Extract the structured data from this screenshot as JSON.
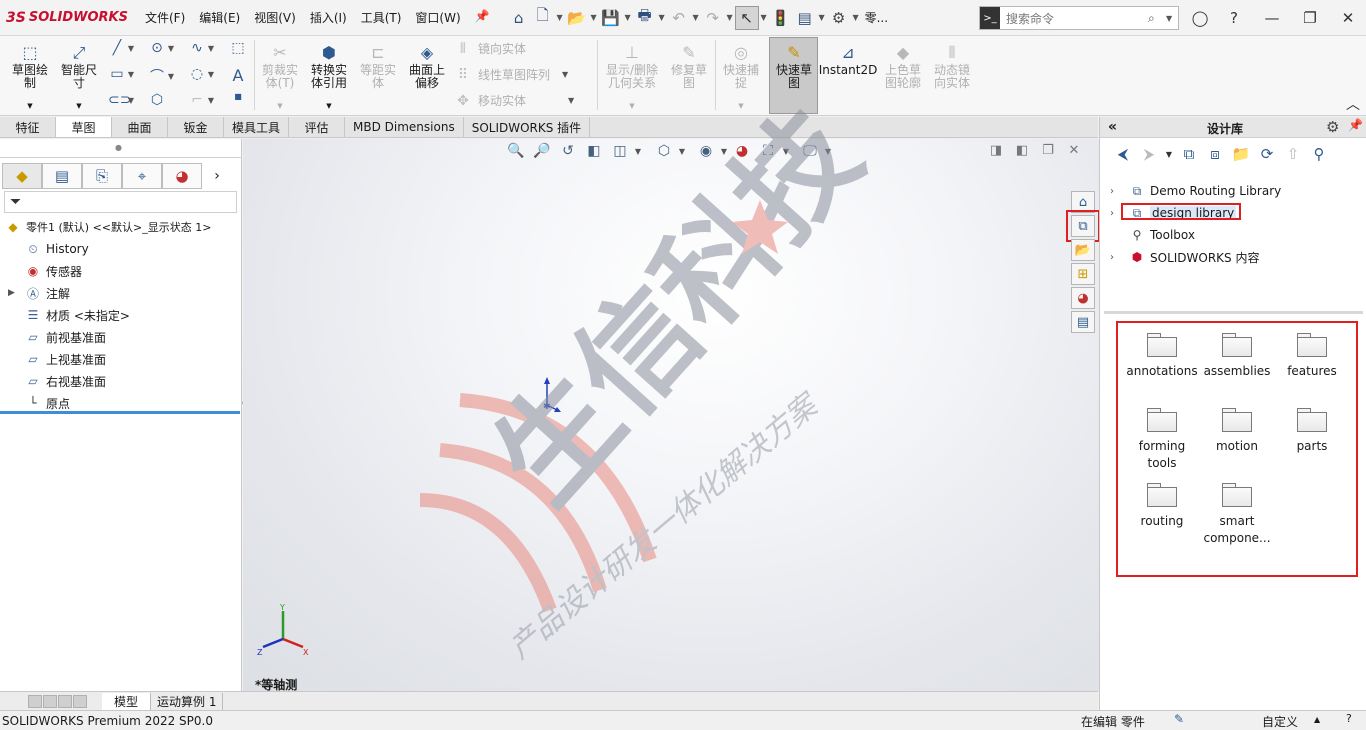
{
  "app": {
    "logo_prefix": "3S",
    "logo_text": "SOLIDWORKS"
  },
  "menu": [
    "文件(F)",
    "编辑(E)",
    "视图(V)",
    "插入(I)",
    "工具(T)",
    "窗口(W)"
  ],
  "quick_access": {
    "doc_short": "零..."
  },
  "search": {
    "placeholder": "搜索命令"
  },
  "ribbon": {
    "sketch": "草图绘\n制",
    "smart_dim": "智能尺\n寸",
    "trim": "剪裁实\n体(T)",
    "convert": "转换实\n体引用",
    "offset": "等距实\n体",
    "surface_offset": "曲面上\n偏移",
    "mirror": "镜向实体",
    "linear_pattern": "线性草图阵列",
    "move": "移动实体",
    "display_delete": "显示/删除\n几何关系",
    "repair": "修复草\n图",
    "quick_snap": "快速捕\n捉",
    "rapid_sketch": "快速草\n图",
    "instant2d": "Instant2D",
    "color_contour": "上色草\n图轮廓",
    "dynamic_mirror": "动态镜\n向实体"
  },
  "tabs": [
    "特征",
    "草图",
    "曲面",
    "钣金",
    "模具工具",
    "评估",
    "MBD Dimensions",
    "SOLIDWORKS 插件"
  ],
  "active_tab": "草图",
  "tree": {
    "root": "零件1 (默认) <<默认>_显示状态 1>",
    "items": [
      "History",
      "传感器",
      "注解",
      "材质 <未指定>",
      "前视基准面",
      "上视基准面",
      "右视基准面",
      "原点"
    ]
  },
  "viewport": {
    "view_label": "*等轴测"
  },
  "triad": {
    "x": "X",
    "y": "Y",
    "z": "Z"
  },
  "watermark": {
    "main": "生信科技",
    "sub": "产品设计研发一体化解决方案"
  },
  "bottom_tabs": [
    "模型",
    "运动算例 1"
  ],
  "design_library": {
    "title": "设计库",
    "tree": [
      "Demo Routing Library",
      "design library",
      "Toolbox",
      "SOLIDWORKS 内容"
    ],
    "folders": [
      "annotations",
      "assemblies",
      "features",
      "forming\ntools",
      "motion",
      "parts",
      "routing",
      "smart\ncompone..."
    ]
  },
  "status": {
    "left": "SOLIDWORKS Premium 2022 SP0.0",
    "editing": "在编辑 零件",
    "custom": "自定义"
  },
  "colors": {
    "highlight": "#e02020",
    "brand": "#c8102e",
    "rollback": "#3a8fd6"
  }
}
